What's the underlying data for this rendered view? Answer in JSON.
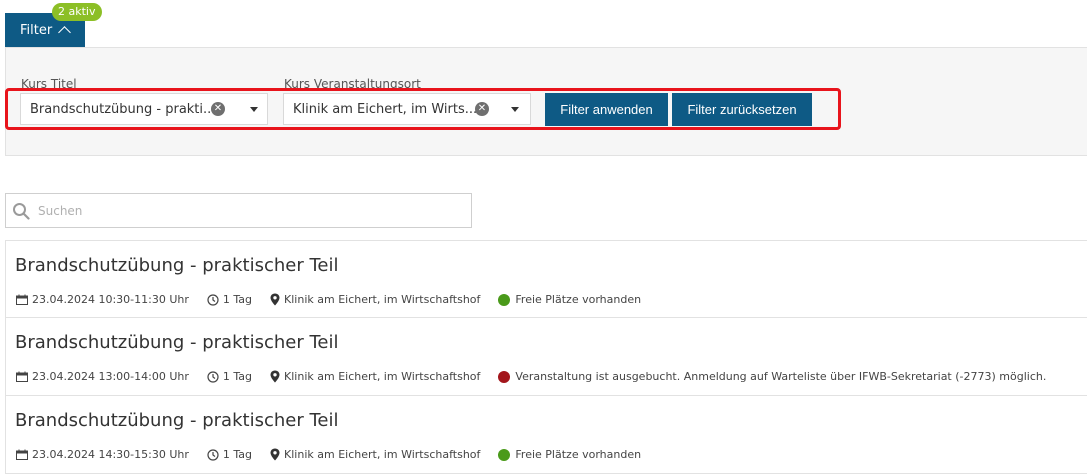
{
  "filter": {
    "tab_label": "Filter",
    "active_badge": "2 aktiv",
    "fields": [
      {
        "label": "Kurs Titel",
        "value": "Brandschutzübung - prakti..."
      },
      {
        "label": "Kurs Veranstaltungsort",
        "value": "Klinik am Eichert, im Wirts..."
      }
    ],
    "apply_label": "Filter anwenden",
    "reset_label": "Filter zurücksetzen"
  },
  "search": {
    "placeholder": "Suchen"
  },
  "courses": [
    {
      "title": "Brandschutzübung - praktischer Teil",
      "datetime": "23.04.2024 10:30-11:30 Uhr",
      "duration": "1 Tag",
      "location": "Klinik am Eichert, im Wirtschaftshof",
      "status": "Freie Plätze vorhanden",
      "status_color": "#4a9a1a"
    },
    {
      "title": "Brandschutzübung - praktischer Teil",
      "datetime": "23.04.2024 13:00-14:00 Uhr",
      "duration": "1 Tag",
      "location": "Klinik am Eichert, im Wirtschaftshof",
      "status": "Veranstaltung ist ausgebucht. Anmeldung auf Warteliste über IFWB-Sekretariat (-2773) möglich.",
      "status_color": "#a3161c"
    },
    {
      "title": "Brandschutzübung - praktischer Teil",
      "datetime": "23.04.2024 14:30-15:30 Uhr",
      "duration": "1 Tag",
      "location": "Klinik am Eichert, im Wirtschaftshof",
      "status": "Freie Plätze vorhanden",
      "status_color": "#4a9a1a"
    }
  ],
  "colors": {
    "primary": "#0e5a85",
    "badge": "#8cbf26",
    "highlight": "#e8141c"
  }
}
